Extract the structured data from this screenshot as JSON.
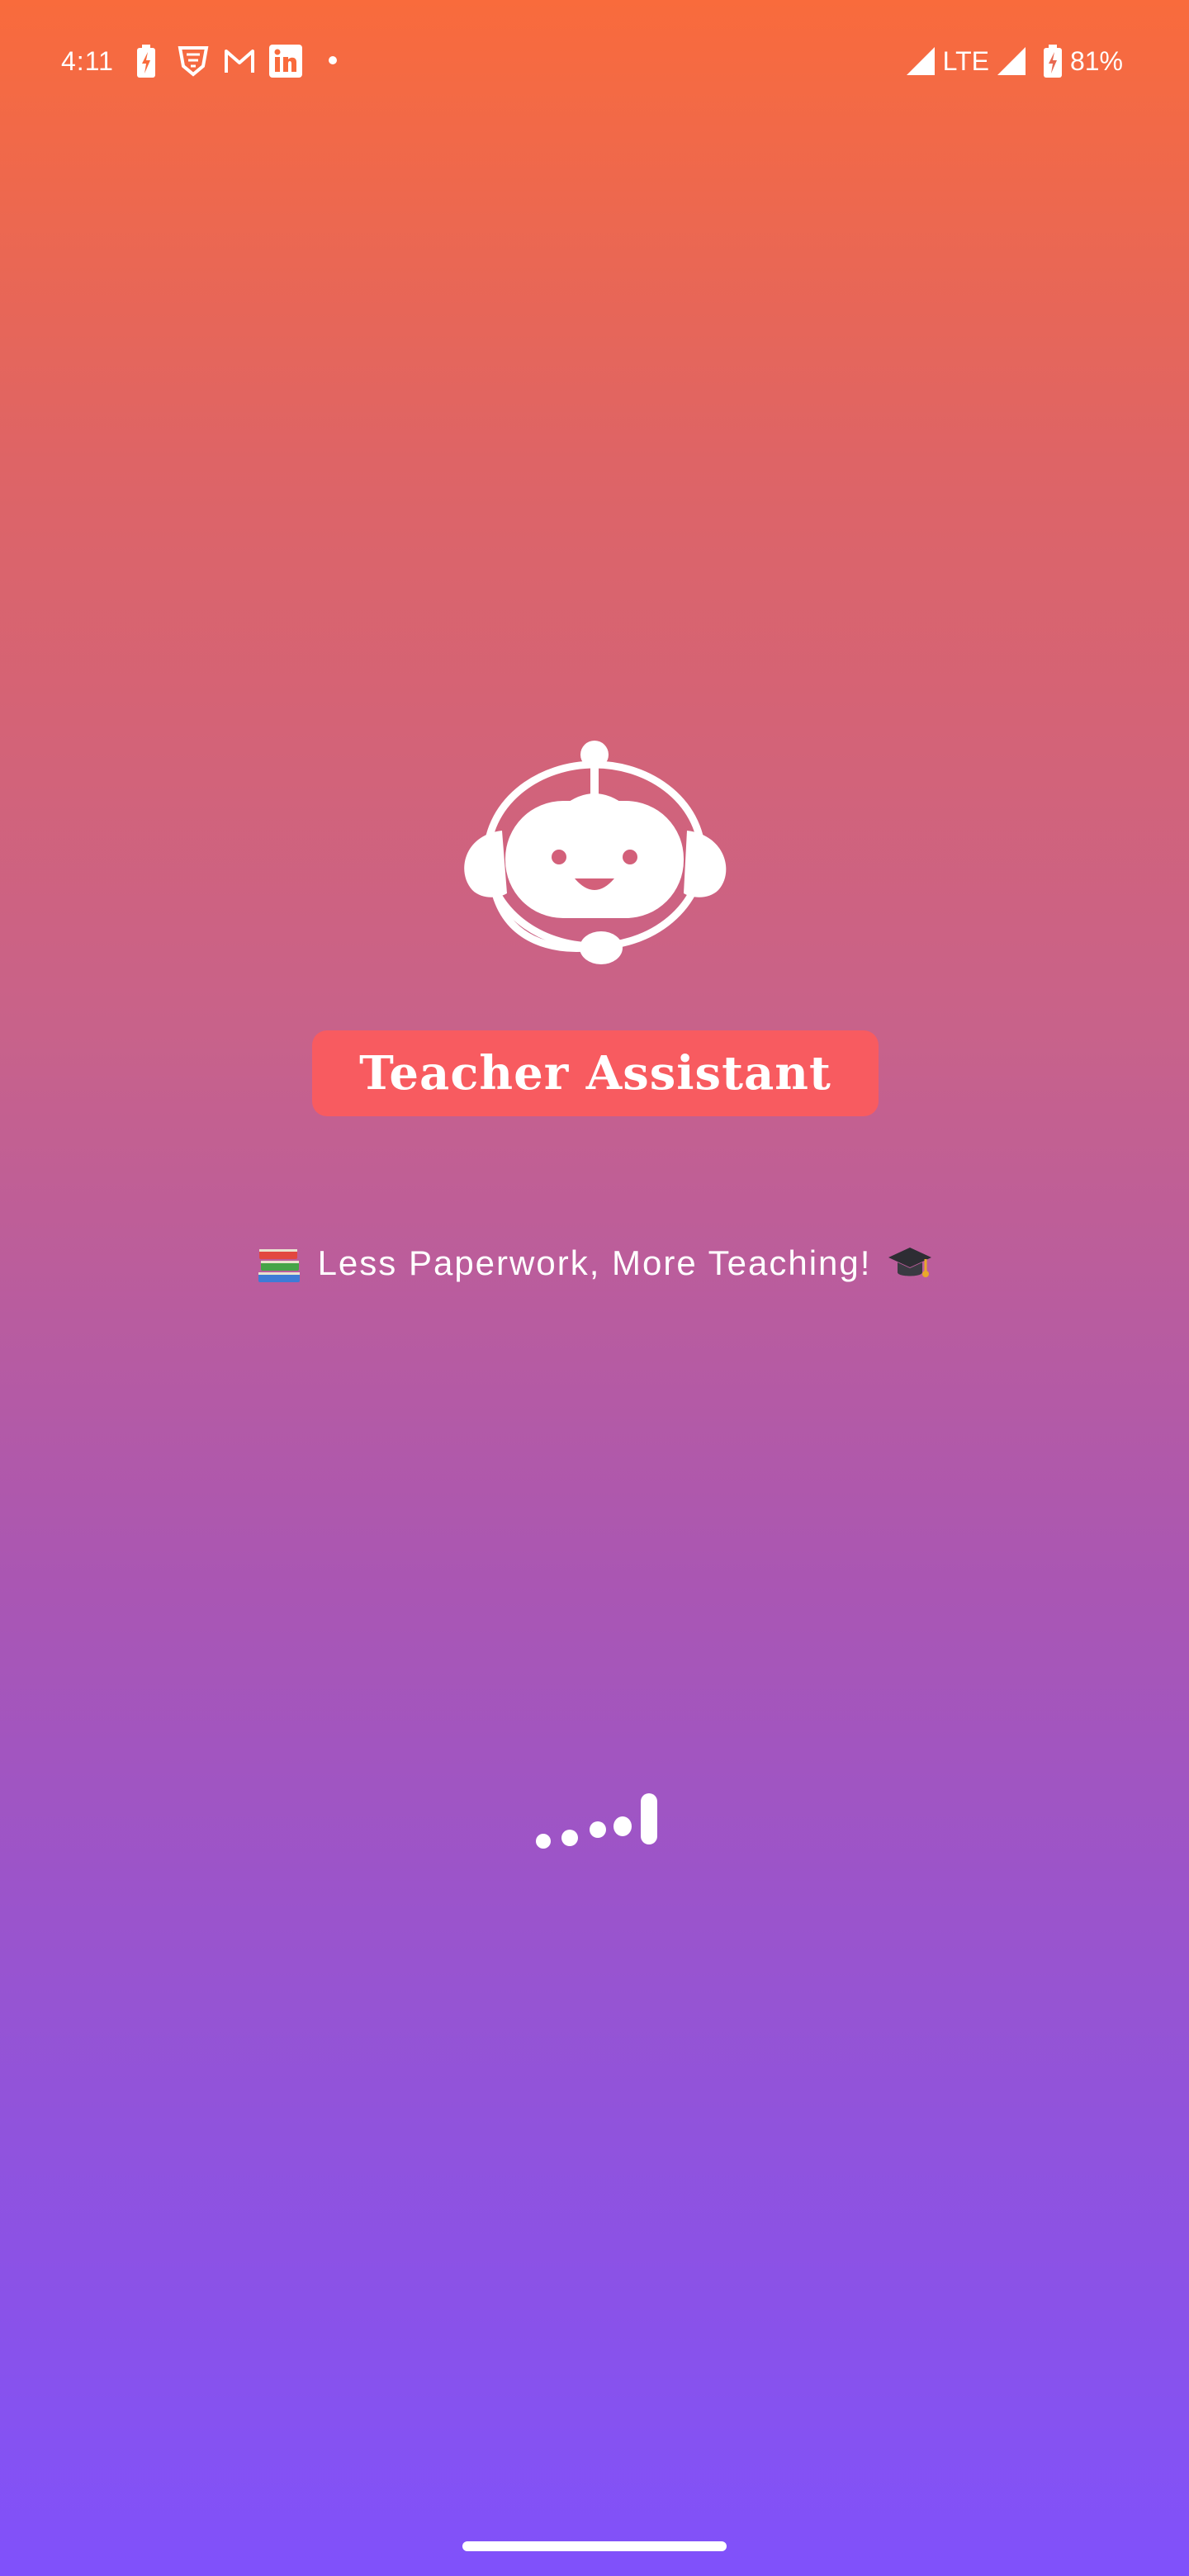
{
  "status_bar": {
    "time": "4:11",
    "network": "LTE",
    "battery": "81%",
    "icons": [
      "battery-saver-icon",
      "vpn-shield-icon",
      "gmail-icon",
      "linkedin-icon",
      "notification-dot-icon",
      "signal-icon",
      "signal-icon",
      "battery-icon"
    ]
  },
  "app": {
    "logo_icon": "robot-headset-icon",
    "title": "Teacher Assistant",
    "tagline": "Less Paperwork, More Teaching!",
    "tagline_emoji_left": "books-icon",
    "tagline_emoji_right": "graduation-cap-icon",
    "loading_indicator": "dots-loading-icon"
  },
  "colors": {
    "gradient_top": "#f96b3c",
    "gradient_bottom": "#8051fb",
    "title_badge": "#f85b60",
    "foreground": "#ffffff"
  }
}
